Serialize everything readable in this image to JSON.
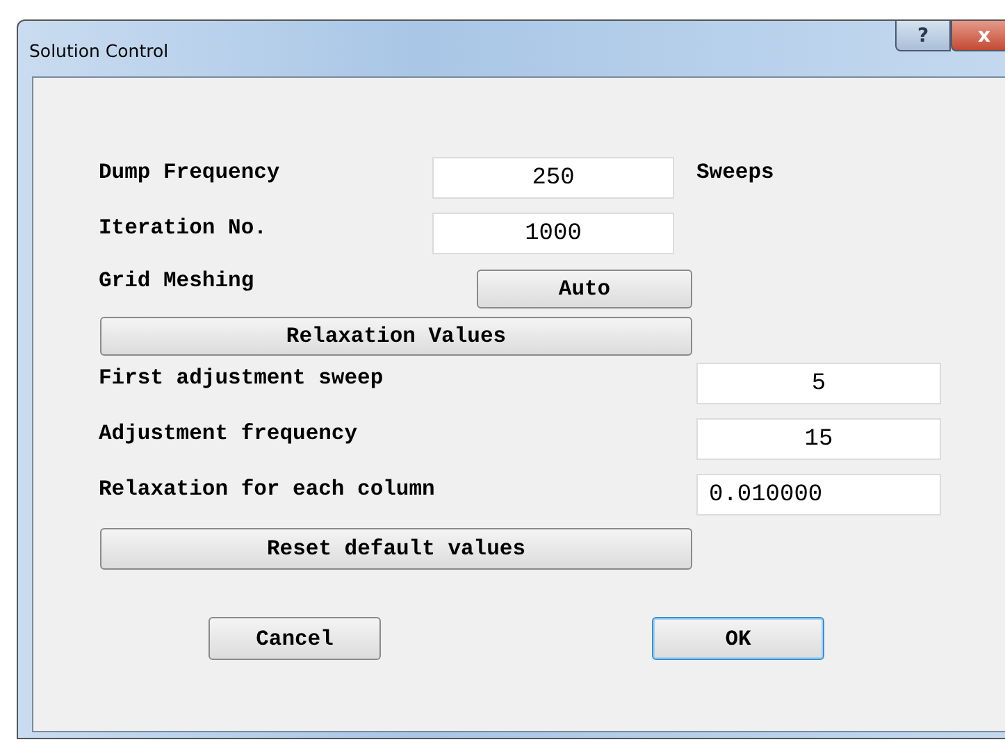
{
  "window": {
    "title": "Solution Control",
    "help_button": "?",
    "close_button": "x"
  },
  "fields": [
    {
      "label": "Dump Frequency",
      "value": "250",
      "unit": "Sweeps",
      "kind": "integer"
    },
    {
      "label": "Iteration No.",
      "value": "1000",
      "kind": "integer"
    }
  ],
  "grid_meshing": {
    "label": "Grid Meshing",
    "button": "Auto"
  },
  "relaxation_button": "Relaxation Values",
  "relaxation_fields": [
    {
      "label": "First adjustment sweep",
      "value": "5",
      "kind": "integer"
    },
    {
      "label": "Adjustment frequency",
      "value": "15",
      "kind": "integer"
    },
    {
      "label": "Relaxation for each column",
      "value": "0.010000",
      "kind": "decimal"
    }
  ],
  "reset_button": "Reset default values",
  "buttons": [
    {
      "label": "Cancel",
      "focused": false
    },
    {
      "label": "OK",
      "focused": true
    }
  ]
}
